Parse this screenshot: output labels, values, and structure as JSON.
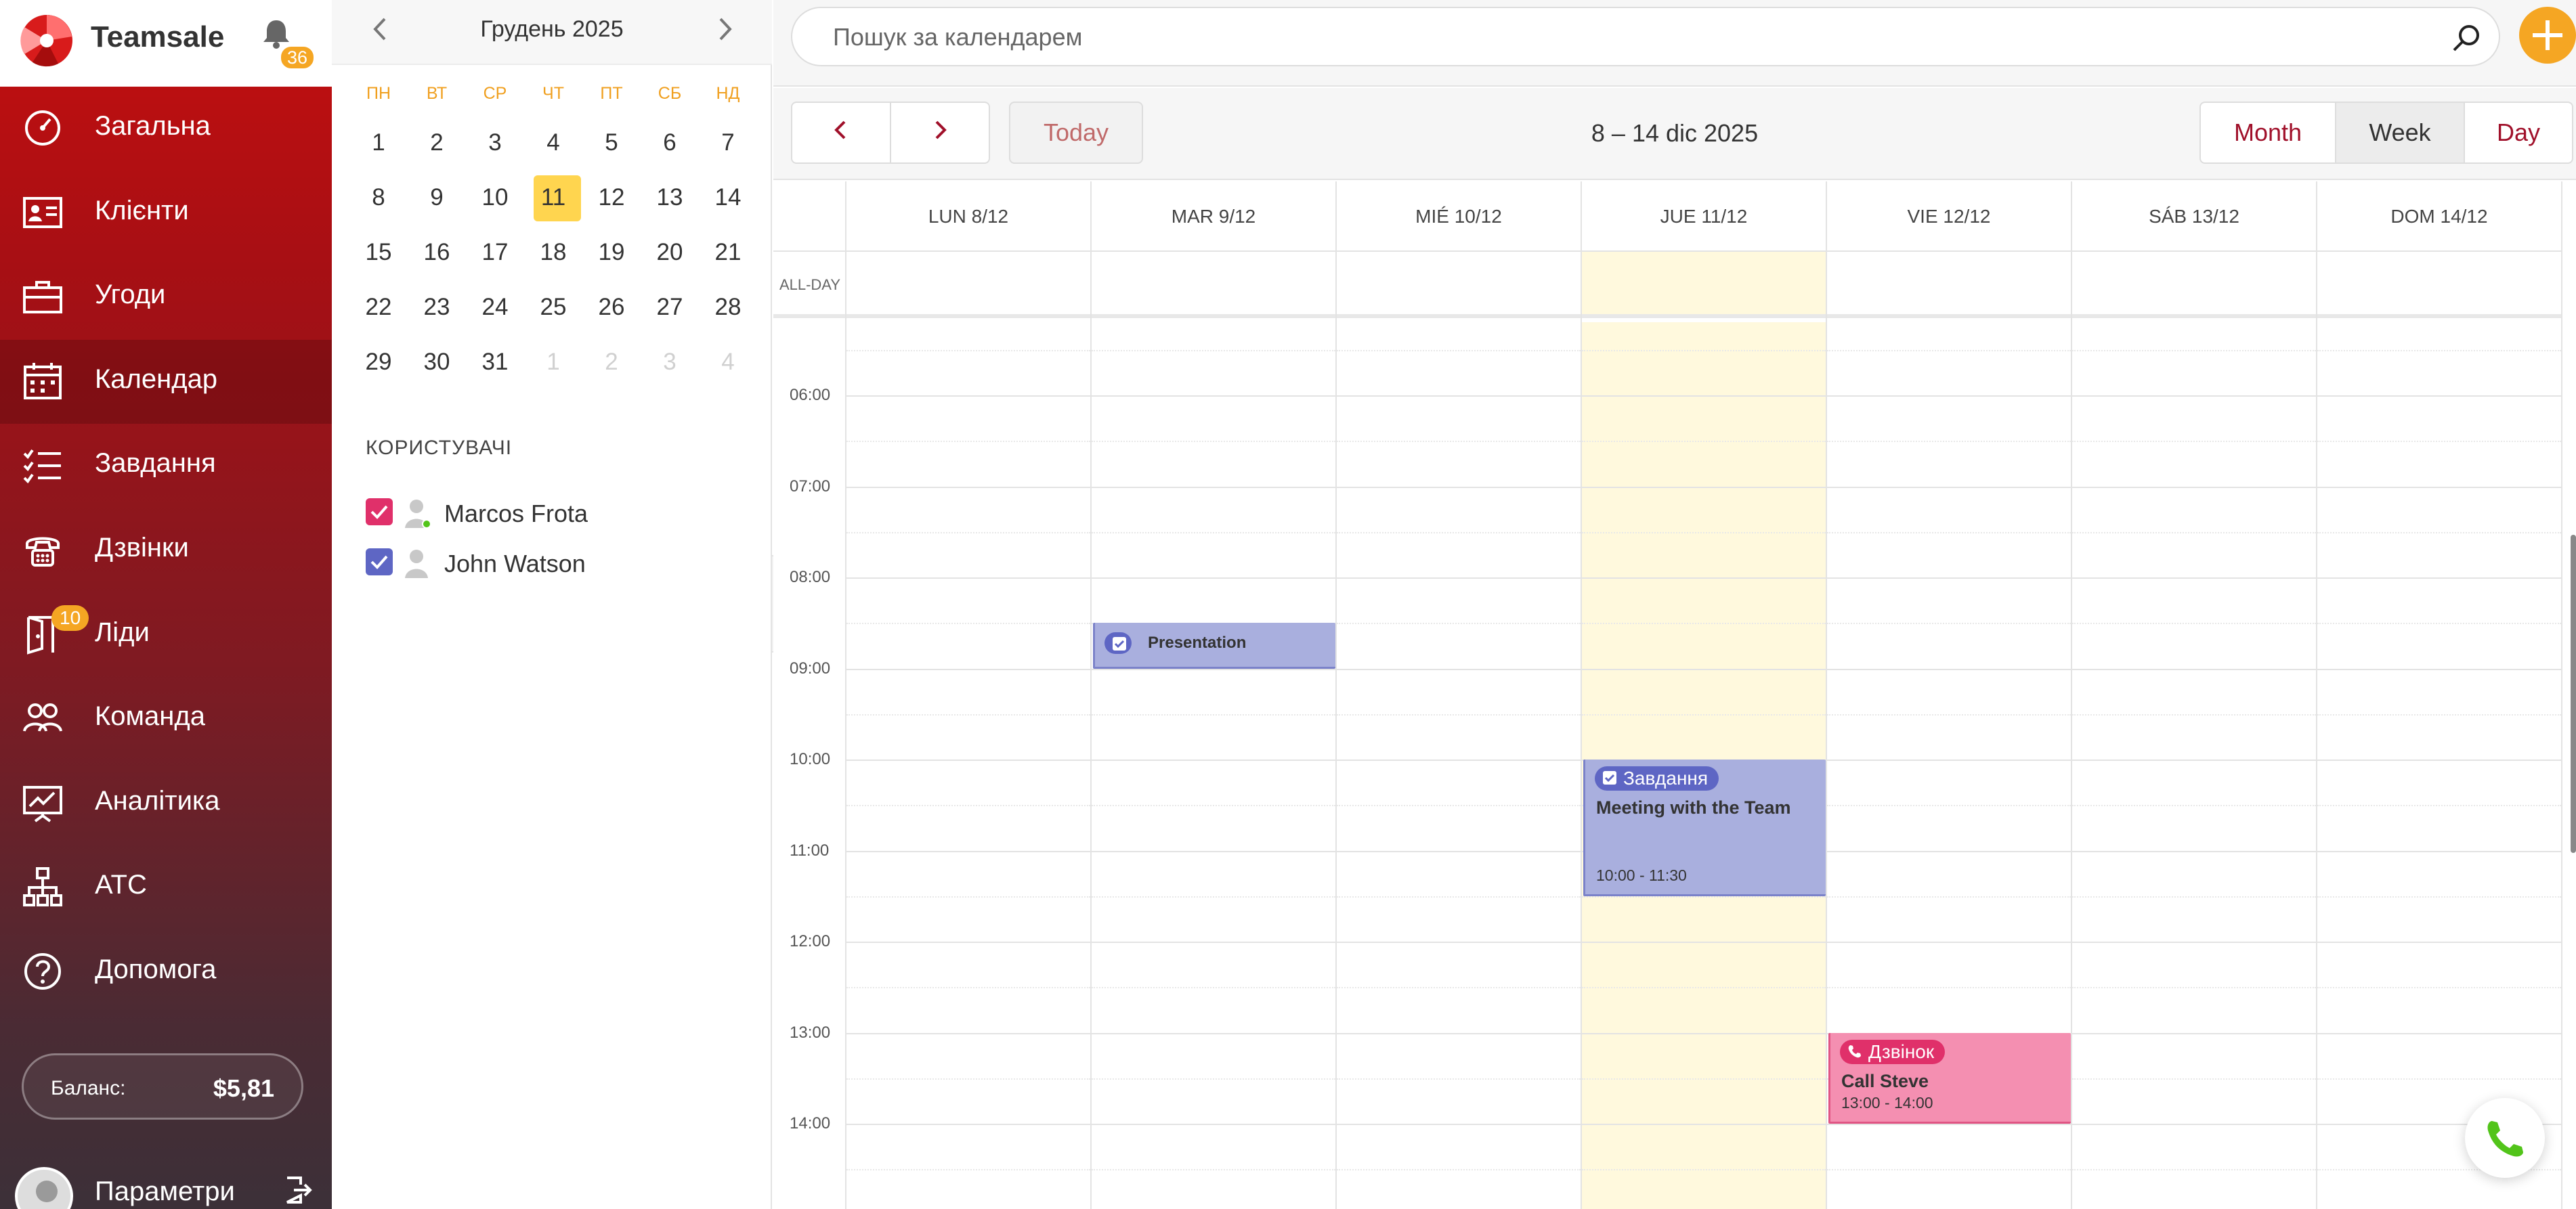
{
  "app": {
    "brand": "Teamsale",
    "notifications_count": "36"
  },
  "sidebar": {
    "items": [
      {
        "label": "Загальна",
        "icon": "gauge-icon"
      },
      {
        "label": "Клієнти",
        "icon": "id-card-icon"
      },
      {
        "label": "Угоди",
        "icon": "briefcase-icon"
      },
      {
        "label": "Календар",
        "icon": "calendar-icon",
        "active": true
      },
      {
        "label": "Завдання",
        "icon": "checklist-icon"
      },
      {
        "label": "Дзвінки",
        "icon": "phone-icon"
      },
      {
        "label": "Ліди",
        "icon": "door-icon",
        "badge": "10"
      },
      {
        "label": "Команда",
        "icon": "team-icon"
      },
      {
        "label": "Аналітика",
        "icon": "chart-board-icon"
      },
      {
        "label": "АТС",
        "icon": "network-icon"
      },
      {
        "label": "Допомога",
        "icon": "help-icon"
      }
    ],
    "balance_label": "Баланс:",
    "balance_value": "$5,81",
    "settings_label": "Параметри"
  },
  "mini_calendar": {
    "title": "Грудень 2025",
    "weekdays": [
      "ПН",
      "ВТ",
      "СР",
      "ЧТ",
      "ПТ",
      "СБ",
      "НД"
    ],
    "days": [
      {
        "d": "1"
      },
      {
        "d": "2"
      },
      {
        "d": "3"
      },
      {
        "d": "4"
      },
      {
        "d": "5"
      },
      {
        "d": "6"
      },
      {
        "d": "7"
      },
      {
        "d": "8"
      },
      {
        "d": "9"
      },
      {
        "d": "10"
      },
      {
        "d": "11",
        "today": true
      },
      {
        "d": "12"
      },
      {
        "d": "13"
      },
      {
        "d": "14"
      },
      {
        "d": "15"
      },
      {
        "d": "16"
      },
      {
        "d": "17"
      },
      {
        "d": "18"
      },
      {
        "d": "19"
      },
      {
        "d": "20"
      },
      {
        "d": "21"
      },
      {
        "d": "22"
      },
      {
        "d": "23"
      },
      {
        "d": "24"
      },
      {
        "d": "25"
      },
      {
        "d": "26"
      },
      {
        "d": "27"
      },
      {
        "d": "28"
      },
      {
        "d": "29"
      },
      {
        "d": "30"
      },
      {
        "d": "31"
      },
      {
        "d": "1",
        "muted": true
      },
      {
        "d": "2",
        "muted": true
      },
      {
        "d": "3",
        "muted": true
      },
      {
        "d": "4",
        "muted": true
      }
    ]
  },
  "users": {
    "heading": "КОРИСТУВАЧІ",
    "list": [
      {
        "name": "Marcos Frota",
        "color": "#e0306a",
        "checked": true
      },
      {
        "name": "John Watson",
        "color": "#5e66c4",
        "checked": true
      }
    ]
  },
  "search": {
    "placeholder": "Пошук за календарем"
  },
  "toolbar": {
    "today_label": "Today",
    "range_title": "8 – 14 dic 2025",
    "views": {
      "month": "Month",
      "week": "Week",
      "day": "Day"
    },
    "active_view": "Week"
  },
  "week": {
    "allday_label": "ALL-DAY",
    "days": [
      {
        "label": "LUN 8/12"
      },
      {
        "label": "MAR 9/12"
      },
      {
        "label": "MIÉ 10/12"
      },
      {
        "label": "JUE 11/12",
        "today": true
      },
      {
        "label": "VIE 12/12"
      },
      {
        "label": "SÁB 13/12"
      },
      {
        "label": "DOM 14/12"
      }
    ],
    "hours": [
      "06:00",
      "07:00",
      "08:00",
      "09:00",
      "10:00",
      "11:00",
      "12:00",
      "13:00",
      "14:00"
    ]
  },
  "events": [
    {
      "day": 1,
      "start": 8.5,
      "end": 9.0,
      "type": "task",
      "title": "Presentation",
      "color": "#a9afde"
    },
    {
      "day": 3,
      "start": 10.0,
      "end": 11.5,
      "type": "task",
      "tag": "Завдання",
      "title": "Meeting with the Team",
      "time": "10:00 - 11:30",
      "color": "#a9afde"
    },
    {
      "day": 4,
      "start": 13.0,
      "end": 14.0,
      "type": "call",
      "tag": "Дзвінок",
      "title": "Call Steve",
      "time": "13:00 - 14:00",
      "color": "#f48fb1"
    }
  ],
  "colors": {
    "brand_red": "#c40f0f",
    "accent_orange": "#f5a623",
    "today_highlight": "#ffd54f",
    "today_column": "#fff9dd"
  }
}
